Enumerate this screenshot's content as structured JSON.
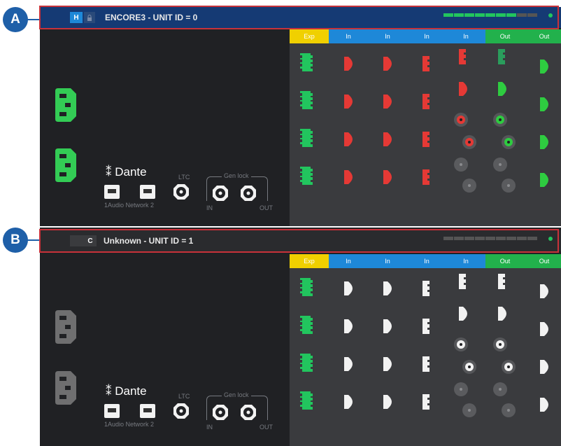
{
  "callouts": [
    {
      "letter": "A"
    },
    {
      "letter": "B"
    }
  ],
  "units": [
    {
      "title": "ENCORE3 - UNIT ID = 0",
      "buttons": [
        "H",
        "🔒"
      ],
      "meter_colors": [
        "#22c55e",
        "#22c55e",
        "#22c55e",
        "#22c55e",
        "#22c55e",
        "#22c55e",
        "#22c55e",
        "#555",
        "#555"
      ],
      "power_color": "#33cc55",
      "active": true
    },
    {
      "title": "Unknown - UNIT ID = 1",
      "buttons": [
        "",
        "C"
      ],
      "meter_colors": [
        "#555",
        "#555",
        "#555",
        "#555",
        "#555",
        "#555",
        "#555",
        "#555",
        "#555"
      ],
      "power_color": "#6f6f70",
      "active": false
    }
  ],
  "columns": [
    {
      "label": "Exp",
      "color": "#f0d000"
    },
    {
      "label": "In",
      "color": "#1e88d8"
    },
    {
      "label": "In",
      "color": "#1e88d8"
    },
    {
      "label": "In",
      "color": "#1e88d8"
    },
    {
      "label": "In",
      "color": "#1e88d8"
    },
    {
      "label": "Out",
      "color": "#22b14c"
    },
    {
      "label": "Out",
      "color": "#22b14c"
    }
  ],
  "network": {
    "brand": "Dante",
    "ltc": "LTC",
    "genlock": "Gen lock",
    "ports_label": "1Audio Network 2",
    "in_label": "IN",
    "out_label": "OUT"
  }
}
